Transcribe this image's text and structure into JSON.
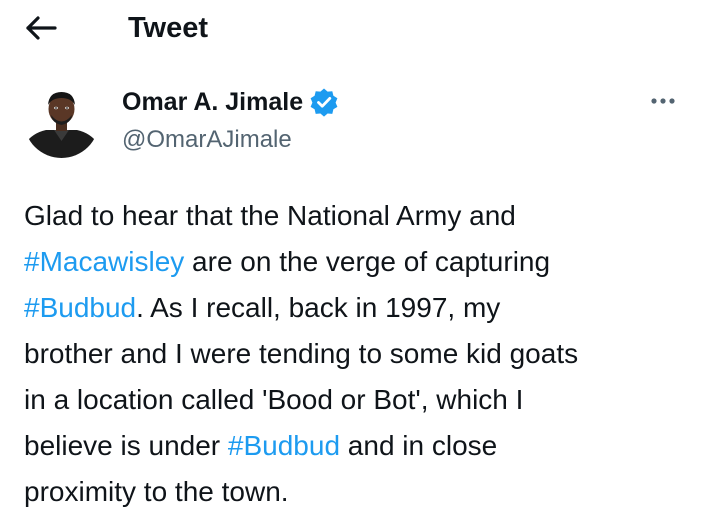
{
  "header": {
    "title": "Tweet",
    "back_icon": "arrow-left-icon"
  },
  "author": {
    "name": "Omar A. Jimale",
    "handle": "@OmarAJimale",
    "verified_icon": "verified-badge-icon",
    "verified_color": "#1d9bf0"
  },
  "more_icon": "more-horizontal-icon",
  "tweet": {
    "lines": [
      [
        {
          "text": "Glad to hear that the National Army and"
        }
      ],
      [
        {
          "text": "#Macawisley",
          "hashtag": true
        },
        {
          "text": " are on the verge of capturing"
        }
      ],
      [
        {
          "text": "#Budbud",
          "hashtag": true
        },
        {
          "text": ". As I recall, back in 1997, my"
        }
      ],
      [
        {
          "text": "brother and I were tending to some kid goats"
        }
      ],
      [
        {
          "text": "in a location called 'Bood or Bot', which I"
        }
      ],
      [
        {
          "text": "believe is under "
        },
        {
          "text": "#Budbud",
          "hashtag": true
        },
        {
          "text": " and in close"
        }
      ],
      [
        {
          "text": "proximity to the town."
        }
      ]
    ]
  },
  "colors": {
    "text": "#0f1419",
    "secondary": "#536471",
    "link": "#1d9bf0"
  }
}
